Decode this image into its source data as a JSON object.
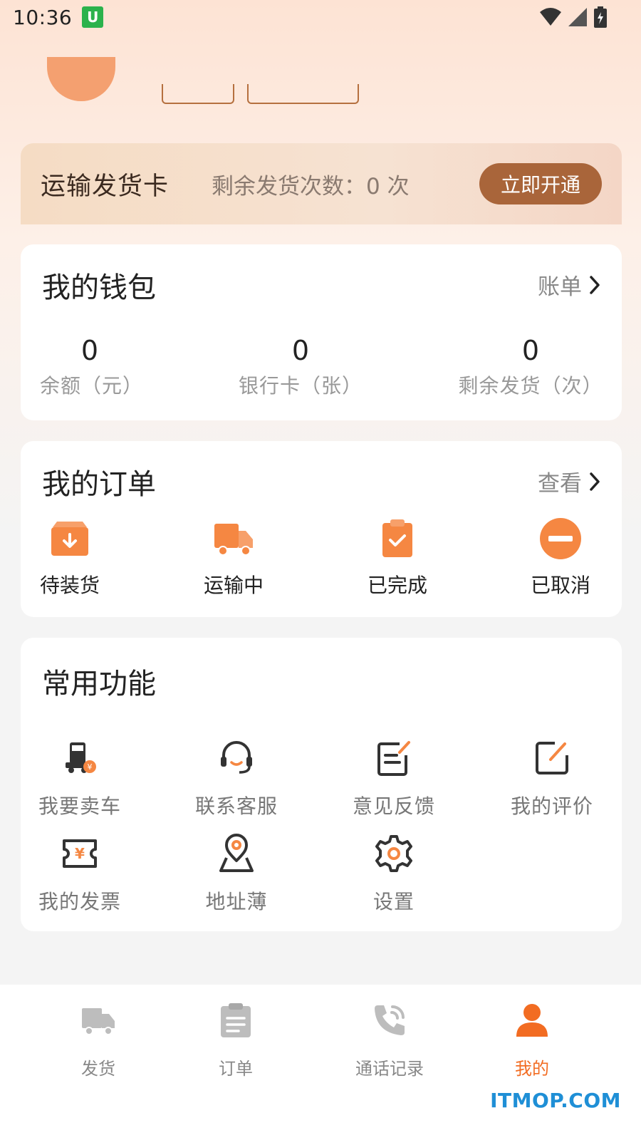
{
  "status_bar": {
    "time": "10:36",
    "app_badge": "U"
  },
  "vip_card": {
    "title": "运输发货卡",
    "remaining_text": "剩余发货次数：",
    "remaining_value": "0 次",
    "button_label": "立即开通"
  },
  "wallet": {
    "title": "我的钱包",
    "link": "账单",
    "stats": [
      {
        "value": "0",
        "label": "余额（元）"
      },
      {
        "value": "0",
        "label": "银行卡（张）"
      },
      {
        "value": "0",
        "label": "剩余发货（次）"
      }
    ]
  },
  "orders": {
    "title": "我的订单",
    "link": "查看",
    "items": [
      {
        "label": "待装货",
        "icon": "box-download-icon"
      },
      {
        "label": "运输中",
        "icon": "truck-icon"
      },
      {
        "label": "已完成",
        "icon": "clipboard-check-icon"
      },
      {
        "label": "已取消",
        "icon": "minus-circle-icon"
      }
    ]
  },
  "functions": {
    "title": "常用功能",
    "items": [
      {
        "label": "我要卖车",
        "icon": "sell-truck-icon"
      },
      {
        "label": "联系客服",
        "icon": "headset-icon"
      },
      {
        "label": "意见反馈",
        "icon": "feedback-icon"
      },
      {
        "label": "我的评价",
        "icon": "edit-icon"
      },
      {
        "label": "我的发票",
        "icon": "invoice-icon"
      },
      {
        "label": "地址薄",
        "icon": "location-icon"
      },
      {
        "label": "设置",
        "icon": "gear-icon"
      }
    ]
  },
  "tab_bar": {
    "items": [
      {
        "label": "发货",
        "icon": "truck-icon",
        "active": false
      },
      {
        "label": "订单",
        "icon": "clipboard-icon",
        "active": false
      },
      {
        "label": "通话记录",
        "icon": "phone-icon",
        "active": false
      },
      {
        "label": "我的",
        "icon": "user-icon",
        "active": true
      }
    ]
  },
  "colors": {
    "accent": "#f26c22",
    "vip_button": "#a9653a",
    "order_icon": "#f58742"
  },
  "watermark": "ITMOP.COM"
}
